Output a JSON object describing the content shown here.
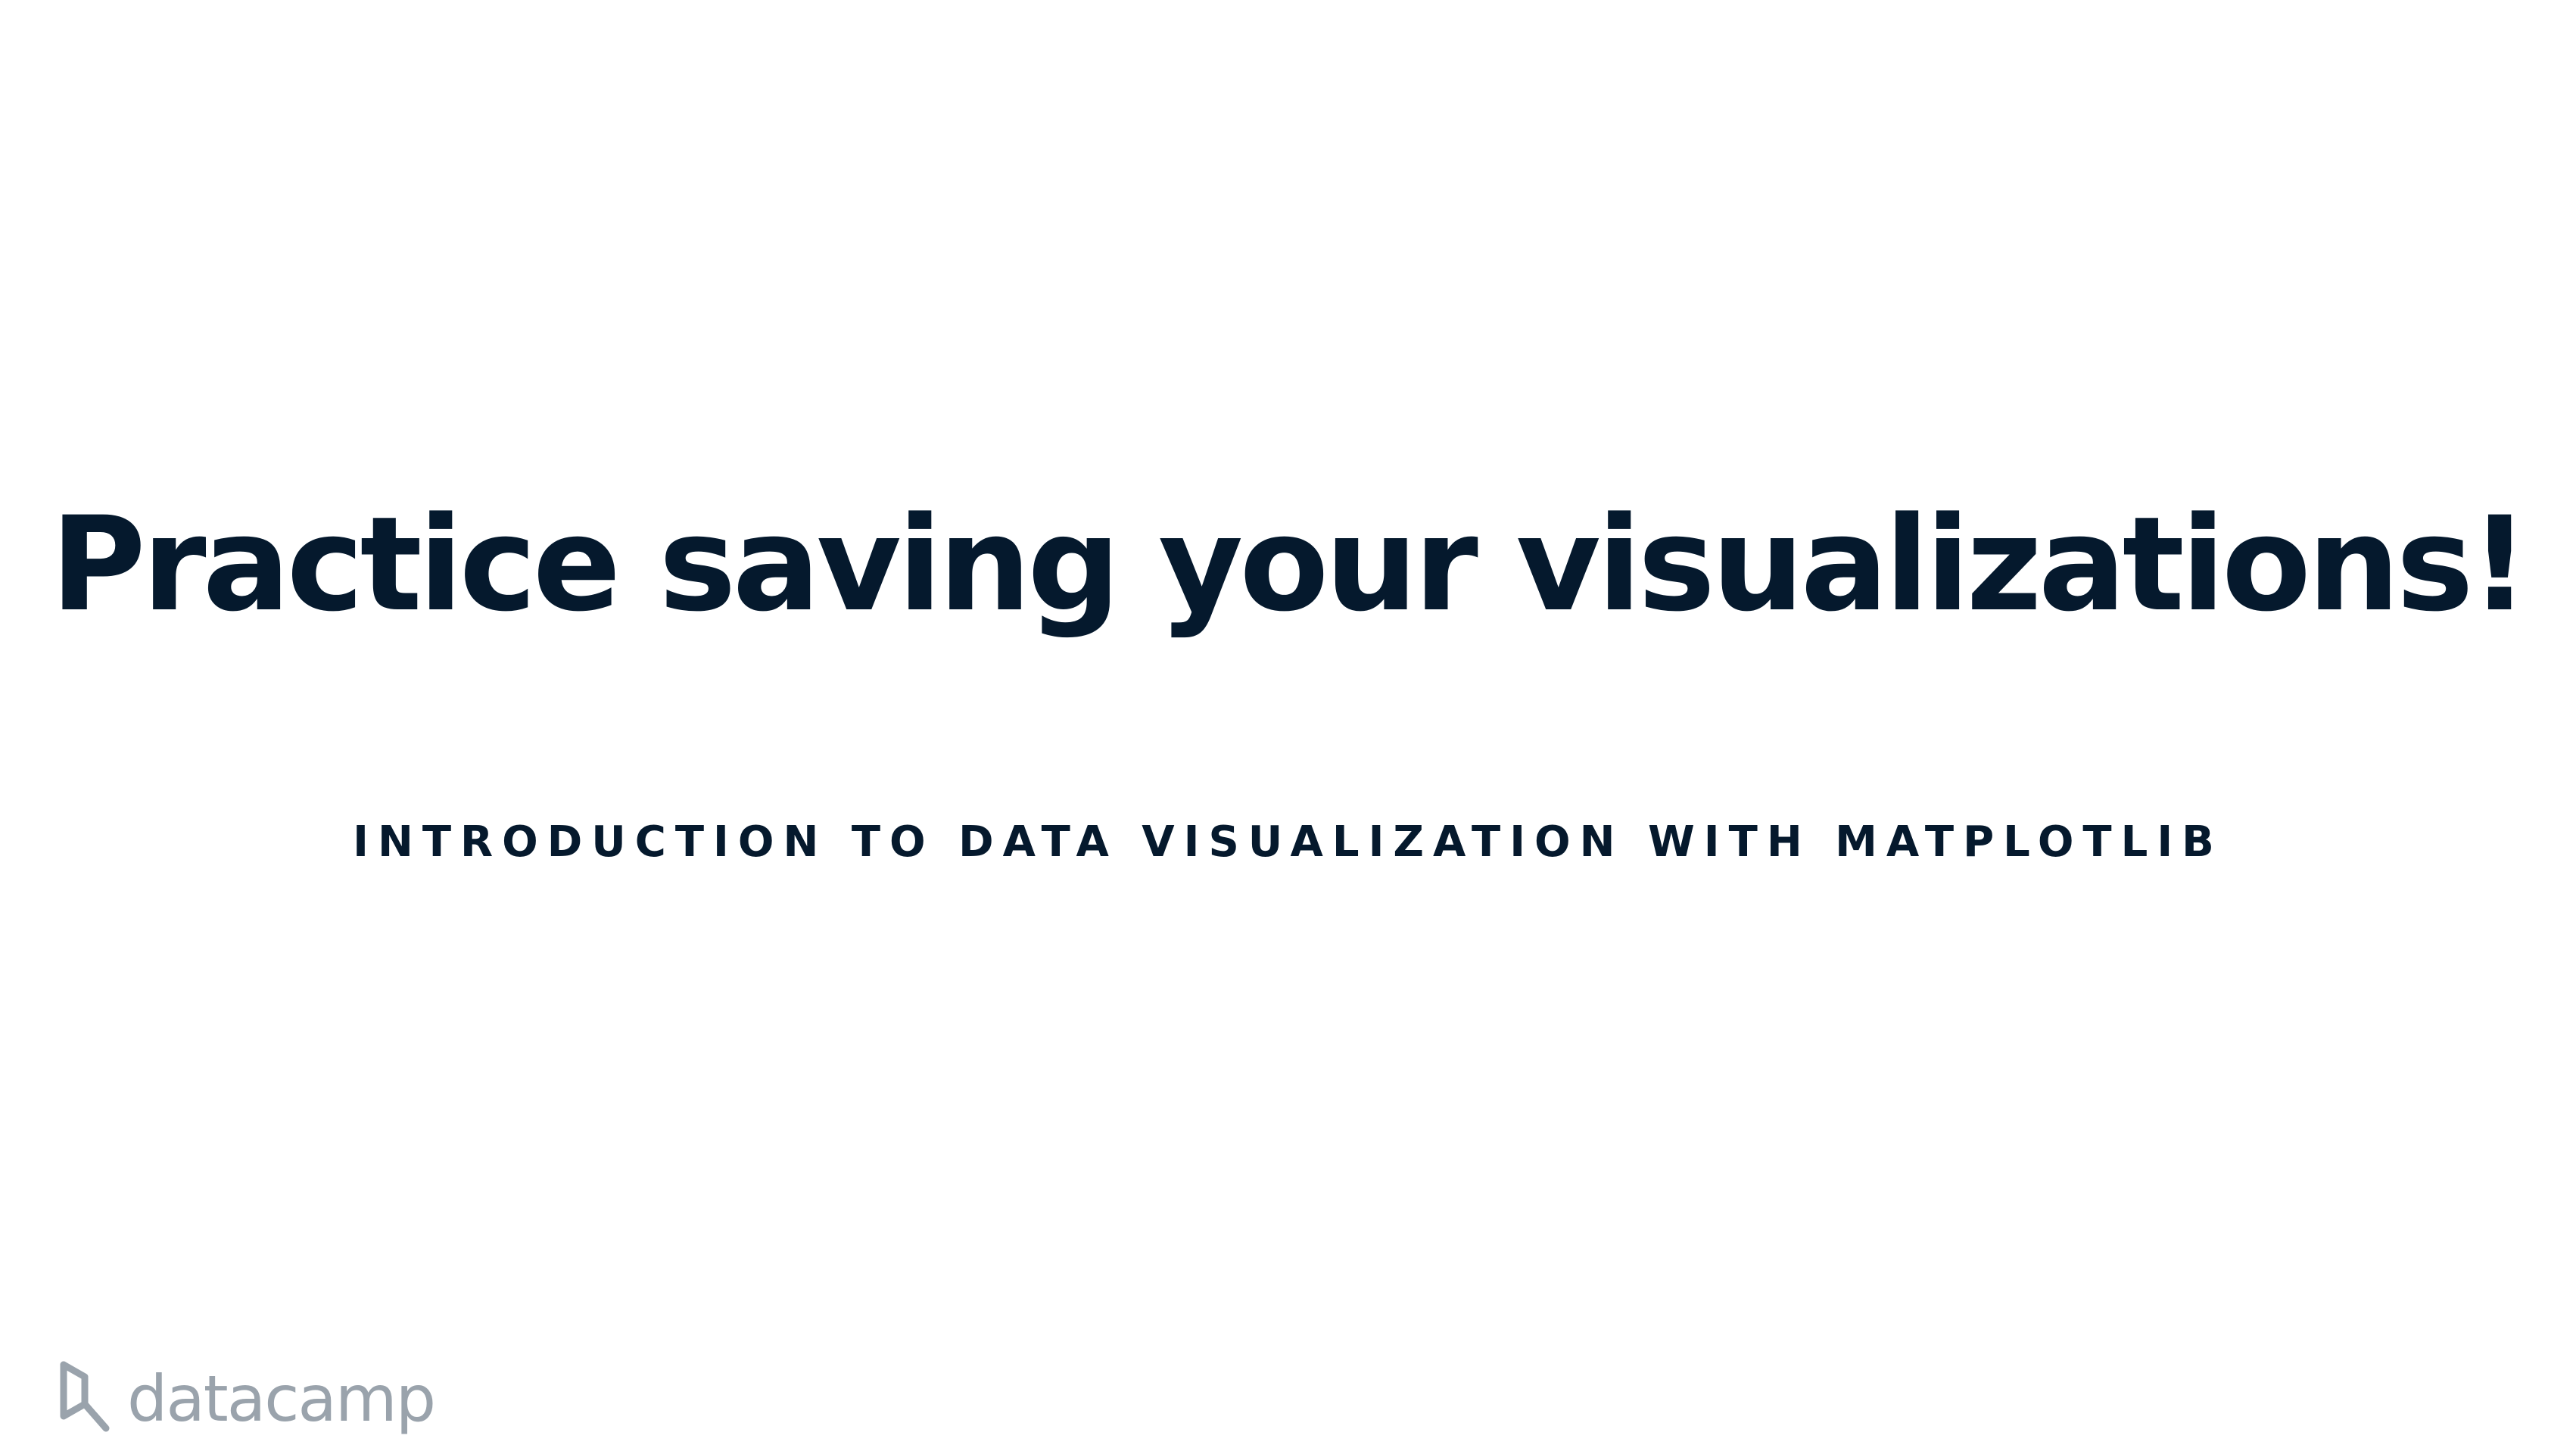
{
  "slide": {
    "title": "Practice saving your visualizations!",
    "subtitle": "INTRODUCTION TO DATA VISUALIZATION WITH MATPLOTLIB"
  },
  "logo": {
    "icon": "datacamp-logo-icon",
    "text": "datacamp"
  },
  "colors": {
    "background": "#ffffff",
    "title": "#05192d",
    "logo": "#9aa3ac"
  }
}
